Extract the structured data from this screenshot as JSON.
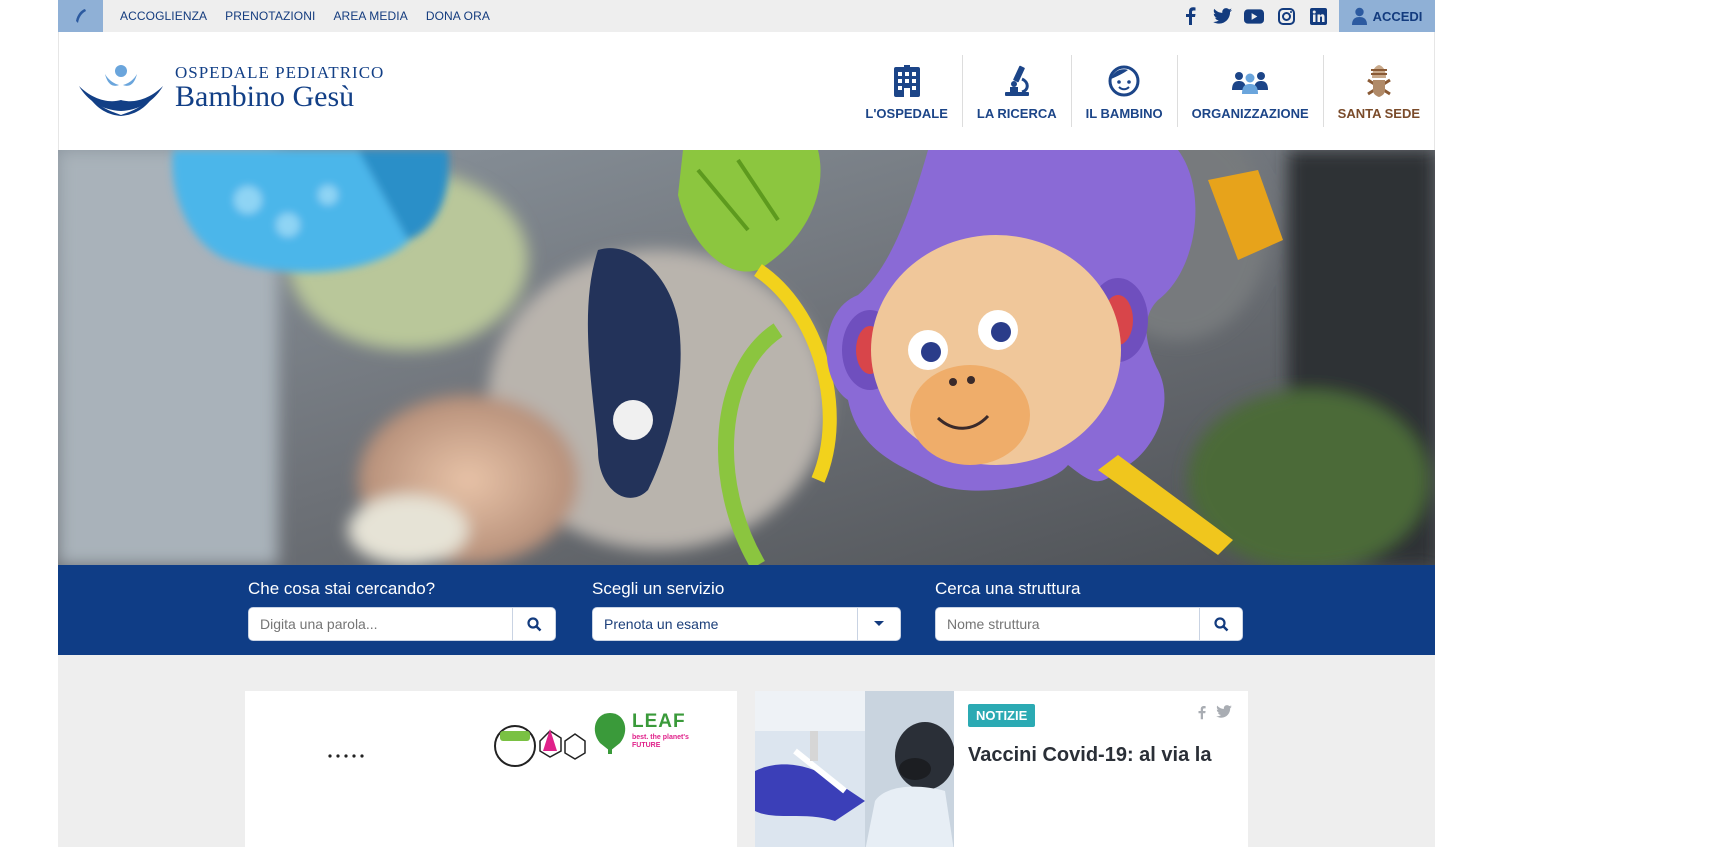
{
  "topbar": {
    "links": [
      "ACCOGLIENZA",
      "PRENOTAZIONI",
      "AREA MEDIA",
      "DONA ORA"
    ],
    "socials": [
      "facebook-icon",
      "twitter-icon",
      "youtube-icon",
      "instagram-icon",
      "linkedin-icon"
    ],
    "login_label": "ACCEDI"
  },
  "logo": {
    "line1": "OSPEDALE PEDIATRICO",
    "line2": "Bambino Gesù"
  },
  "nav": [
    {
      "label": "L'OSPEDALE",
      "icon": "hospital-building-icon"
    },
    {
      "label": "LA RICERCA",
      "icon": "microscope-icon"
    },
    {
      "label": "IL BAMBINO",
      "icon": "child-face-icon"
    },
    {
      "label": "ORGANIZZAZIONE",
      "icon": "people-group-icon"
    },
    {
      "label": "SANTA SEDE",
      "icon": "papal-coat-of-arms-icon"
    }
  ],
  "search": {
    "keyword": {
      "label": "Che cosa stai cercando?",
      "placeholder": "Digita una parola..."
    },
    "service": {
      "label": "Scegli un servizio",
      "selected": "Prenota un esame"
    },
    "structure": {
      "label": "Cerca una struttura",
      "placeholder": "Nome struttura"
    }
  },
  "cards": {
    "left": {
      "logo_text": "LEAF",
      "logo_sub": "best. the planet's FUTURE"
    },
    "news": {
      "badge": "NOTIZIE",
      "title": "Vaccini Covid-19: al via la"
    }
  },
  "colors": {
    "primary": "#0f3d86",
    "topbar_bg": "#eeeeee",
    "accent_light": "#8fb0d6",
    "badge": "#2baab3"
  }
}
